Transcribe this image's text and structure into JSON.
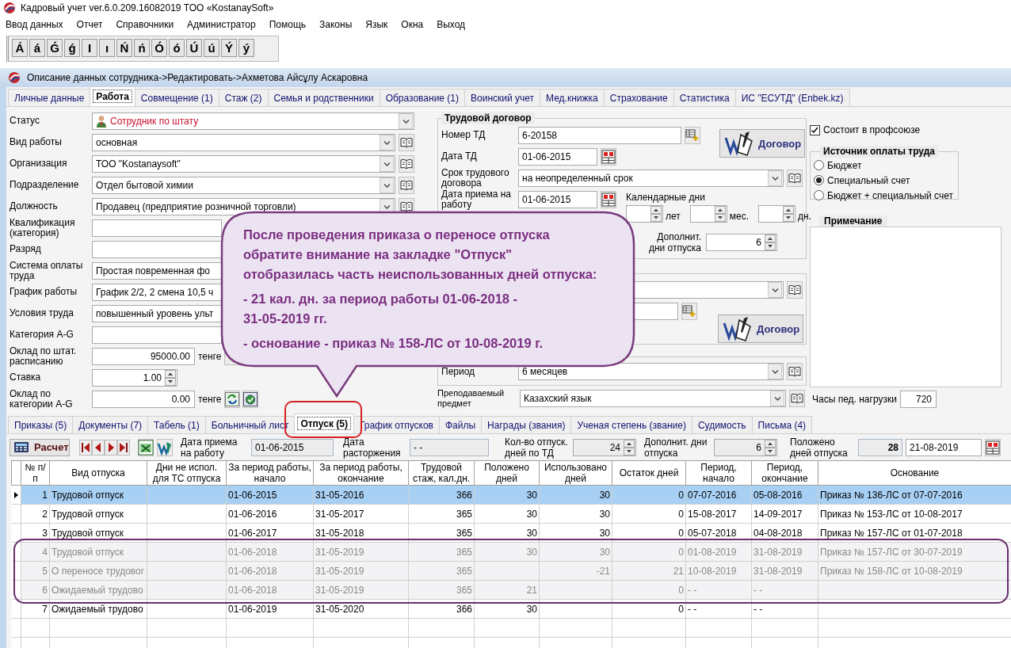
{
  "app": {
    "title": "Кадровый учет ver.6.0.209.16082019 ТОО «KostanaySoft»"
  },
  "menu": [
    "Ввод данных",
    "Отчет",
    "Справочники",
    "Администратор",
    "Помощь",
    "Законы",
    "Язык",
    "Окна",
    "Выход"
  ],
  "letters": [
    "Á",
    "á",
    "Ǵ",
    "ǵ",
    "I",
    "ı",
    "Ń",
    "ń",
    "Ó",
    "ó",
    "Ú",
    "ú",
    "Ý",
    "ý"
  ],
  "window": {
    "title": "Описание данных сотрудника->Редактировать->Ахметова Айсұлу Аскаровна"
  },
  "top_tabs": [
    {
      "label": "Личные данные",
      "selected": false
    },
    {
      "label": "Работа",
      "selected": true
    },
    {
      "label": "Совмещение (1)",
      "selected": false
    },
    {
      "label": "Стаж (2)",
      "selected": false
    },
    {
      "label": "Семья и родственники",
      "selected": false
    },
    {
      "label": "Образование (1)",
      "selected": false
    },
    {
      "label": "Воинский учет",
      "selected": false
    },
    {
      "label": "Мед.книжка",
      "selected": false
    },
    {
      "label": "Страхование",
      "selected": false
    },
    {
      "label": "Статистика",
      "selected": false
    },
    {
      "label": "ИС \"ЕСУТД\" (Enbek.kz)",
      "selected": false
    }
  ],
  "left_fields": [
    {
      "kind": "status",
      "label": "Статус",
      "value": "Сотрудник по штату"
    },
    {
      "kind": "combo",
      "label": "Вид работы",
      "value": "основная"
    },
    {
      "kind": "combo",
      "label": "Организация",
      "value": "ТОО \"Kostanaysoft\""
    },
    {
      "kind": "combo",
      "label": "Подразделение",
      "value": "Отдел бытовой химии"
    },
    {
      "kind": "combo",
      "label": "Должность",
      "value": "Продавец (предприятие розничной торговли)"
    },
    {
      "kind": "combo",
      "label": "Квалификация (категория)"
    },
    {
      "kind": "combo",
      "label": "Разряд"
    },
    {
      "kind": "combo",
      "label": "Система оплаты труда",
      "value": "Простая повременная фо"
    },
    {
      "kind": "combo",
      "label": "График работы",
      "value": "График 2/2, 2 смена 10,5 ч"
    },
    {
      "kind": "combo",
      "label": "Условия труда",
      "value": "повышенный уровень ульт"
    },
    {
      "kind": "combo",
      "label": "Категория A-G"
    },
    {
      "kind": "amount",
      "label": "Оклад по штат. расписанию",
      "value": "95000.00",
      "unit": "тенге"
    },
    {
      "kind": "spin",
      "label": "Ставка",
      "value": "1.00"
    },
    {
      "kind": "amount",
      "label": "Оклад по категории A-G",
      "value": "0.00",
      "unit": "тенге"
    }
  ],
  "contract": {
    "title": "Трудовой договор",
    "number_label": "Номер ТД",
    "number": "6-20158",
    "date_label": "Дата ТД",
    "date": "01-06-2015",
    "term_label": "Срок трудового договора",
    "term": "на неопределенный срок",
    "hire_label": "Дата приема на работу",
    "hire": "01-06-2015",
    "calendar_label": "Календарные дни",
    "units": [
      "лет",
      "мес.",
      "дн."
    ],
    "extra_label": "Дополнит. дни отпуска",
    "extra": "6",
    "button": "Договор"
  },
  "liability": {
    "button": "Договор"
  },
  "summary": {
    "period_label": "Период",
    "period": "6 месяцев"
  },
  "subject": {
    "label": "Преподаваемый предмет",
    "value": "Казахский язык"
  },
  "union": {
    "label": "Состоит в профсоюзе",
    "checked": true
  },
  "payment": {
    "title": "Источник оплаты труда",
    "options": [
      {
        "label": "Бюджет",
        "selected": false
      },
      {
        "label": "Специальный счет",
        "selected": true
      },
      {
        "label": "Бюджет + специальный счет",
        "selected": false
      }
    ]
  },
  "notes": {
    "title": "Примечание"
  },
  "hours": {
    "label": "Часы пед. нагрузки",
    "value": "720"
  },
  "bottom_tabs": [
    {
      "label": "Приказы (5)",
      "selected": false,
      "circled": false
    },
    {
      "label": "Документы (7)",
      "selected": false,
      "circled": false
    },
    {
      "label": "Табель (1)",
      "selected": false,
      "circled": false
    },
    {
      "label": "Больничный лист",
      "selected": false,
      "circled": false
    },
    {
      "label": "Отпуск (5)",
      "selected": true,
      "circled": true
    },
    {
      "label": "График отпусков",
      "selected": false,
      "circled": false
    },
    {
      "label": "Файлы",
      "selected": false,
      "circled": false
    },
    {
      "label": "Награды (звания)",
      "selected": false,
      "circled": false
    },
    {
      "label": "Ученая степень (звание)",
      "selected": false,
      "circled": false
    },
    {
      "label": "Судимость",
      "selected": false,
      "circled": false
    },
    {
      "label": "Письма (4)",
      "selected": false,
      "circled": false
    }
  ],
  "vacation_toolbar": {
    "calc_button": "Расчет",
    "hire_label": "Дата приема на работу",
    "hire": "01-06-2015",
    "dismiss_label": "Дата расторжения",
    "dismiss": "- -",
    "days_label": "Кол-во отпуск. дней по ТД",
    "days": "24",
    "extra_label": "Дополнит. дни отпуска",
    "extra": "6",
    "total_label": "Положено дней отпуска",
    "total": "28",
    "date": "21-08-2019"
  },
  "grid": {
    "columns": [
      "№ п/п",
      "Вид отпуска",
      "Дни не испол. для ТС отпуска",
      "За период работы, начало",
      "За период работы, окончание",
      "Трудовой стаж, кал.дн.",
      "Положено дней",
      "Использовано дней",
      "Остаток дней",
      "Период, начало",
      "Период, окончание",
      "Основание"
    ],
    "rows": [
      {
        "selected": true,
        "highlighted": false,
        "cells": [
          "1",
          "Трудовой отпуск",
          "",
          "01-06-2015",
          "31-05-2016",
          "366",
          "30",
          "30",
          "0",
          "07-07-2016",
          "05-08-2016",
          "Приказ № 136-ЛС от 07-07-2016"
        ]
      },
      {
        "selected": false,
        "highlighted": false,
        "cells": [
          "2",
          "Трудовой отпуск",
          "",
          "01-06-2016",
          "31-05-2017",
          "365",
          "30",
          "30",
          "0",
          "15-08-2017",
          "14-09-2017",
          "Приказ № 153-ЛС от 10-08-2017"
        ]
      },
      {
        "selected": false,
        "highlighted": false,
        "cells": [
          "3",
          "Трудовой отпуск",
          "",
          "01-06-2017",
          "31-05-2018",
          "365",
          "30",
          "30",
          "0",
          "05-07-2018",
          "04-08-2018",
          "Приказ № 157-ЛС от 01-07-2018"
        ]
      },
      {
        "selected": false,
        "highlighted": true,
        "cells": [
          "4",
          "Трудовой отпуск",
          "",
          "01-06-2018",
          "31-05-2019",
          "365",
          "30",
          "30",
          "0",
          "01-08-2019",
          "31-08-2019",
          "Приказ № 157-ЛС от 30-07-2019"
        ]
      },
      {
        "selected": false,
        "highlighted": true,
        "cells": [
          "5",
          "О переносе трудовог",
          "",
          "01-06-2018",
          "31-05-2019",
          "365",
          "",
          "-21",
          "21",
          "10-08-2019",
          "31-08-2019",
          "Приказ № 158-ЛС от 10-08-2019"
        ]
      },
      {
        "selected": false,
        "highlighted": true,
        "cells": [
          "6",
          "Ожидаемый трудово",
          "",
          "01-06-2018",
          "31-05-2019",
          "365",
          "21",
          "",
          "0",
          "- -",
          "- -",
          ""
        ]
      },
      {
        "selected": false,
        "highlighted": false,
        "cells": [
          "7",
          "Ожидаемый трудово",
          "",
          "01-06-2019",
          "31-05-2020",
          "366",
          "30",
          "",
          "0",
          "- -",
          "- -",
          ""
        ]
      }
    ]
  },
  "callout": {
    "paragraphs": [
      "После проведения приказа о переносе отпуска\nобратите внимание на закладке \"Отпуск\"\nотобразилась часть неиспользованных дней отпуска:",
      "- 21 кал. дн. за период работы 01-06-2018 -\n31-05-2019 гг.",
      "- основание - приказ № 158-ЛС от 10-08-2019 г."
    ]
  }
}
